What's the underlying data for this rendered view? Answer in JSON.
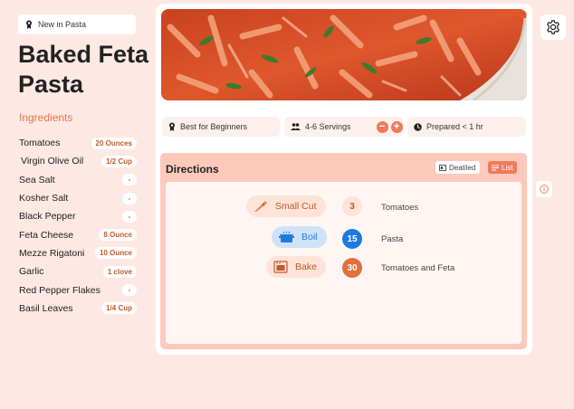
{
  "badge": {
    "label": "New in Pasta",
    "icon": "ribbon-icon"
  },
  "recipe": {
    "title": "Baked Feta Pasta"
  },
  "ingredients": {
    "heading": "Ingredients",
    "items": [
      {
        "name": "Tomatoes",
        "amount": "20 Ounces"
      },
      {
        "name": "Virgin Olive Oil",
        "amount": "1/2 Cup"
      },
      {
        "name": "Sea Salt",
        "amount": "-"
      },
      {
        "name": "Kosher Salt",
        "amount": "-"
      },
      {
        "name": "Black Pepper",
        "amount": "-"
      },
      {
        "name": "Feta Cheese",
        "amount": "8 Ounce"
      },
      {
        "name": "Mezze Rigatoni",
        "amount": "10 Ounce"
      },
      {
        "name": "Garlic",
        "amount": "1 clove"
      },
      {
        "name": "Red Pepper Flakes",
        "amount": "-"
      },
      {
        "name": "Basil Leaves",
        "amount": "1/4 Cup"
      }
    ]
  },
  "info": {
    "level": {
      "label": "Best for Beginners",
      "icon": "ribbon-icon"
    },
    "servings": {
      "label": "4-6 Servings",
      "icon": "people-icon",
      "minus": "−",
      "plus": "+"
    },
    "time": {
      "label": "Prepared < 1 hr",
      "icon": "clock-icon"
    }
  },
  "directions": {
    "title": "Directions",
    "view_detailed": "Deatiled",
    "view_list": "List",
    "active_view": "List",
    "steps": [
      {
        "action": "Small Cut",
        "icon": "knife-icon",
        "count": "3",
        "target": "Tomatoes"
      },
      {
        "action": "Boil",
        "icon": "pot-icon",
        "count": "15",
        "target": "Pasta"
      },
      {
        "action": "Bake",
        "icon": "oven-icon",
        "count": "30",
        "target": "Tomatoes and Feta"
      }
    ]
  },
  "colors": {
    "accent": "#f07a5a",
    "background": "#fde8e4",
    "directions_bg": "#fcc9bb",
    "boil_blue": "#1e7ae0",
    "orange_text": "#c25a2a"
  }
}
